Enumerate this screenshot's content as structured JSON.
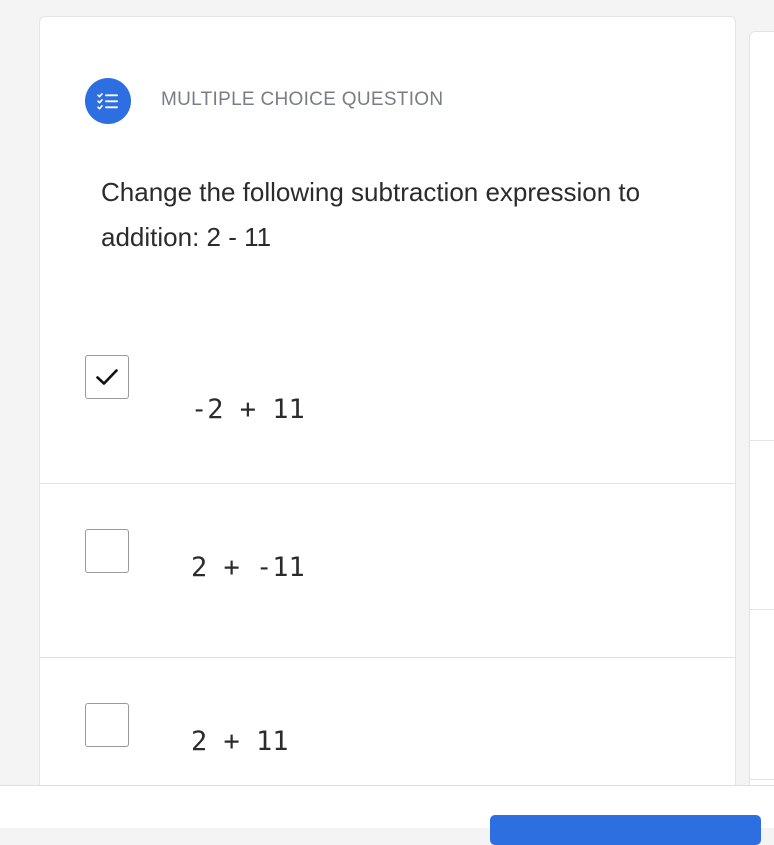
{
  "question": {
    "type_label": "MULTIPLE CHOICE QUESTION",
    "type_icon": "list-check-icon",
    "text": "Change the following subtraction expression to addition: 2 - 11"
  },
  "options": [
    {
      "label": "-2 + 11",
      "checked": true
    },
    {
      "label": "2 + -11",
      "checked": false
    },
    {
      "label": "2 + 11",
      "checked": false
    }
  ],
  "colors": {
    "accent": "#2d6ee0",
    "text": "#2b2b2b",
    "muted": "#7a7d85"
  }
}
